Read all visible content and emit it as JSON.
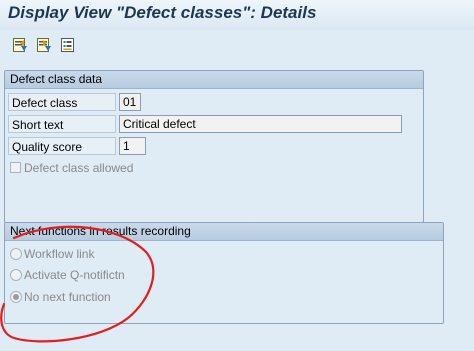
{
  "window": {
    "title": "Display View \"Defect classes\": Details"
  },
  "toolbar": {
    "buttons": [
      {
        "icon": "previous-entry-icon"
      },
      {
        "icon": "next-entry-icon"
      },
      {
        "icon": "other-entry-icon"
      }
    ]
  },
  "defect_class_data": {
    "header": "Defect class data",
    "fields": {
      "defect_class": {
        "label": "Defect class",
        "value": "01"
      },
      "short_text": {
        "label": "Short text",
        "value": "Critical defect"
      },
      "quality_score": {
        "label": "Quality score",
        "value": "1"
      }
    },
    "checkbox": {
      "label": "Defect class allowed",
      "checked": false
    }
  },
  "next_functions": {
    "header": "Next functions in results recording",
    "options": [
      {
        "label": "Workflow link",
        "selected": false
      },
      {
        "label": "Activate Q-notifictn",
        "selected": false
      },
      {
        "label": "No next function",
        "selected": true
      }
    ]
  },
  "colors": {
    "background": "#dfebf5",
    "title_text": "#1e3751",
    "annotation_stroke": "#e0201f"
  }
}
